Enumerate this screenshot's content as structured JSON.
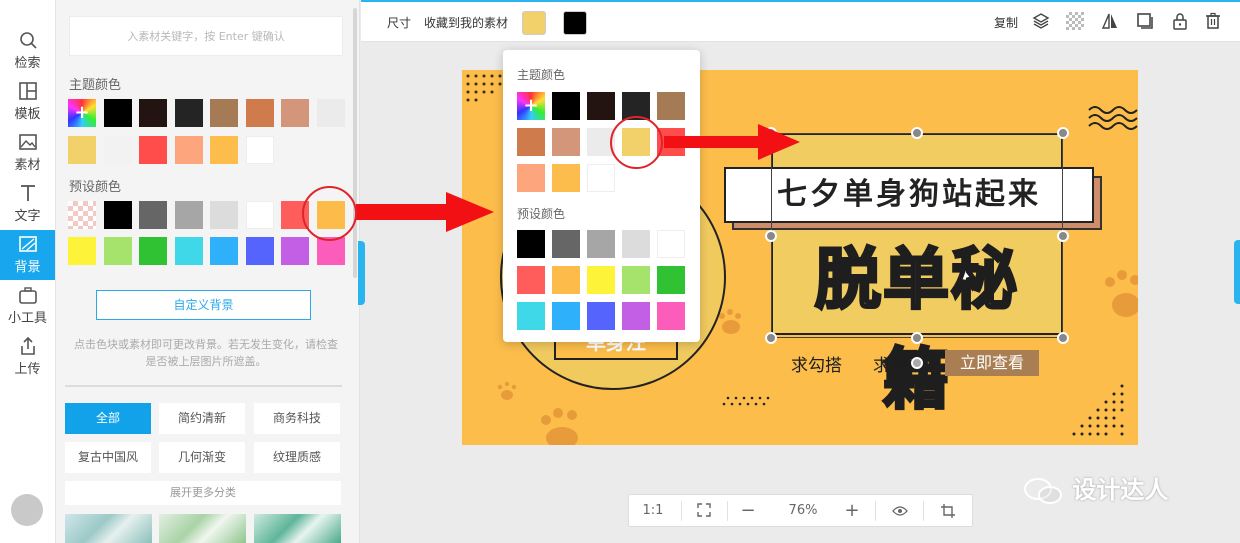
{
  "nav": {
    "items": [
      {
        "label": "检索",
        "icon": "search-icon"
      },
      {
        "label": "模板",
        "icon": "template-icon"
      },
      {
        "label": "素材",
        "icon": "image-icon"
      },
      {
        "label": "文字",
        "icon": "text-icon"
      },
      {
        "label": "背景",
        "icon": "background-icon"
      },
      {
        "label": "小工具",
        "icon": "toolbox-icon"
      },
      {
        "label": "上传",
        "icon": "upload-icon"
      }
    ],
    "active_index": 4
  },
  "panel": {
    "search_placeholder": "入素材关键字，按 Enter 键确认",
    "theme_label": "主题颜色",
    "theme_colors": [
      "rainbow",
      "#000000",
      "#231412",
      "#242424",
      "#a57b55",
      "#d07b4c",
      "#d3967a",
      "#ebebeb",
      "#f2d06a",
      "#f2f2f2",
      "#fe4d4b",
      "#fda57d",
      "#fdbd4c",
      "#ffffff"
    ],
    "preset_label": "预设颜色",
    "preset_colors": [
      "checker",
      "#000000",
      "#666666",
      "#a6a6a6",
      "#dcdcdc",
      "#ffffff",
      "#ff5d5b",
      "#fdbc4a",
      "#fdf43a",
      "#a5e36c",
      "#30c232",
      "#3fd8e8",
      "#2eb0fa",
      "#5464fc",
      "#c35fe5",
      "#fc5dba"
    ],
    "custom_button": "自定义背景",
    "hint": "点击色块或素材即可更改背景。若无发生变化，请检查是否被上层图片所遮盖。",
    "categories": [
      "全部",
      "简约清新",
      "商务科技",
      "复古中国风",
      "几何渐变",
      "纹理质感"
    ],
    "more": "展开更多分类"
  },
  "toolbar": {
    "size": "尺寸",
    "collect": "收藏到我的素材",
    "fill_color": "#f2d06a",
    "stroke_color": "#000000",
    "copy": "复制",
    "icons": [
      "layers-icon",
      "transparency-icon",
      "flip-icon",
      "shadow-icon",
      "lock-icon",
      "trash-icon"
    ]
  },
  "dropdown": {
    "theme_label": "主题颜色",
    "theme_colors": [
      "rainbow",
      "#000000",
      "#231412",
      "#242424",
      "#a57b55",
      "#d07b4c",
      "#d3967a",
      "#ebebeb",
      "#f2d06a",
      "#fe4d4b",
      "#fda57d",
      "#fdbd4c",
      "#ffffff"
    ],
    "preset_label": "预设颜色",
    "preset_colors": [
      "#000000",
      "#666666",
      "#a6a6a6",
      "#dcdcdc",
      "#ffffff",
      "#ff5d5b",
      "#fdbc4a",
      "#fdf43a",
      "#a5e36c",
      "#30c232",
      "#3fd8e8",
      "#2eb0fa",
      "#5464fc",
      "#c35fe5",
      "#fc5dba"
    ]
  },
  "canvas": {
    "banner_text": "七夕单身狗站起来",
    "headline": "脱单秘籍",
    "sub1": "求勾搭",
    "sub2": "求脱单",
    "cta": "立即查看",
    "badge": "单身汪"
  },
  "zoom": {
    "ratio": "1:1",
    "level": "76%"
  },
  "watermark": "设计达人",
  "colors": {
    "accent": "#18a7ee",
    "annotation": "#e0242a",
    "canvas_bg": "#fcbd4b"
  }
}
